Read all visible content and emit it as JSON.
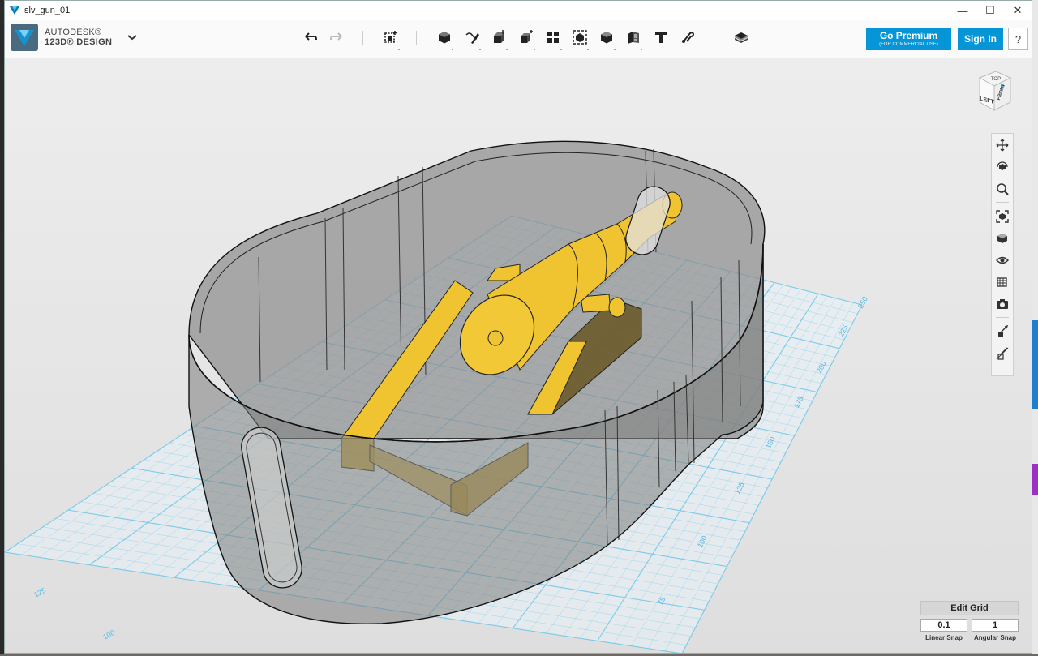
{
  "window": {
    "title": "slv_gun_01",
    "controls": [
      "minimize-icon",
      "maximize-icon",
      "close-icon"
    ]
  },
  "brand": {
    "line1": "AUTODESK®",
    "line2": "123D® DESIGN"
  },
  "toolbar": {
    "tools": [
      "undo-icon",
      "redo-icon",
      "transform-icon",
      "primitives-icon",
      "sketch-icon",
      "construct-icon",
      "modify-icon",
      "pattern-icon",
      "group-icon",
      "combine-icon",
      "measure-icon",
      "text-icon",
      "snap-icon",
      "material-icon"
    ],
    "premium_label": "Go Premium",
    "premium_sub": "(FOR COMMERCIAL USE)",
    "signin_label": "Sign In",
    "help_label": "?"
  },
  "viewcube": {
    "face_left": "LEFT",
    "face_front": "FRONT",
    "face_top": "TOP"
  },
  "navbar": {
    "tools": [
      "pan-icon",
      "orbit-icon",
      "zoom-icon",
      "fit-icon",
      "views-icon",
      "visibility-icon",
      "materials-outline-icon",
      "camera-icon",
      "snap-on-icon",
      "snap-off-icon"
    ]
  },
  "grid": {
    "ticks_right": [
      "250",
      "225",
      "200",
      "175",
      "150",
      "125",
      "100",
      "75"
    ],
    "ticks_left": [
      "125",
      "100"
    ]
  },
  "grid_panel": {
    "edit_label": "Edit Grid",
    "linear_value": "0.1",
    "angular_value": "1",
    "linear_label": "Linear Snap",
    "angular_label": "Angular Snap"
  },
  "colors": {
    "accent": "#0696d7",
    "grid": "#6ec6e8",
    "cannon": "#f0c430",
    "shell": "#8c8c8c"
  }
}
